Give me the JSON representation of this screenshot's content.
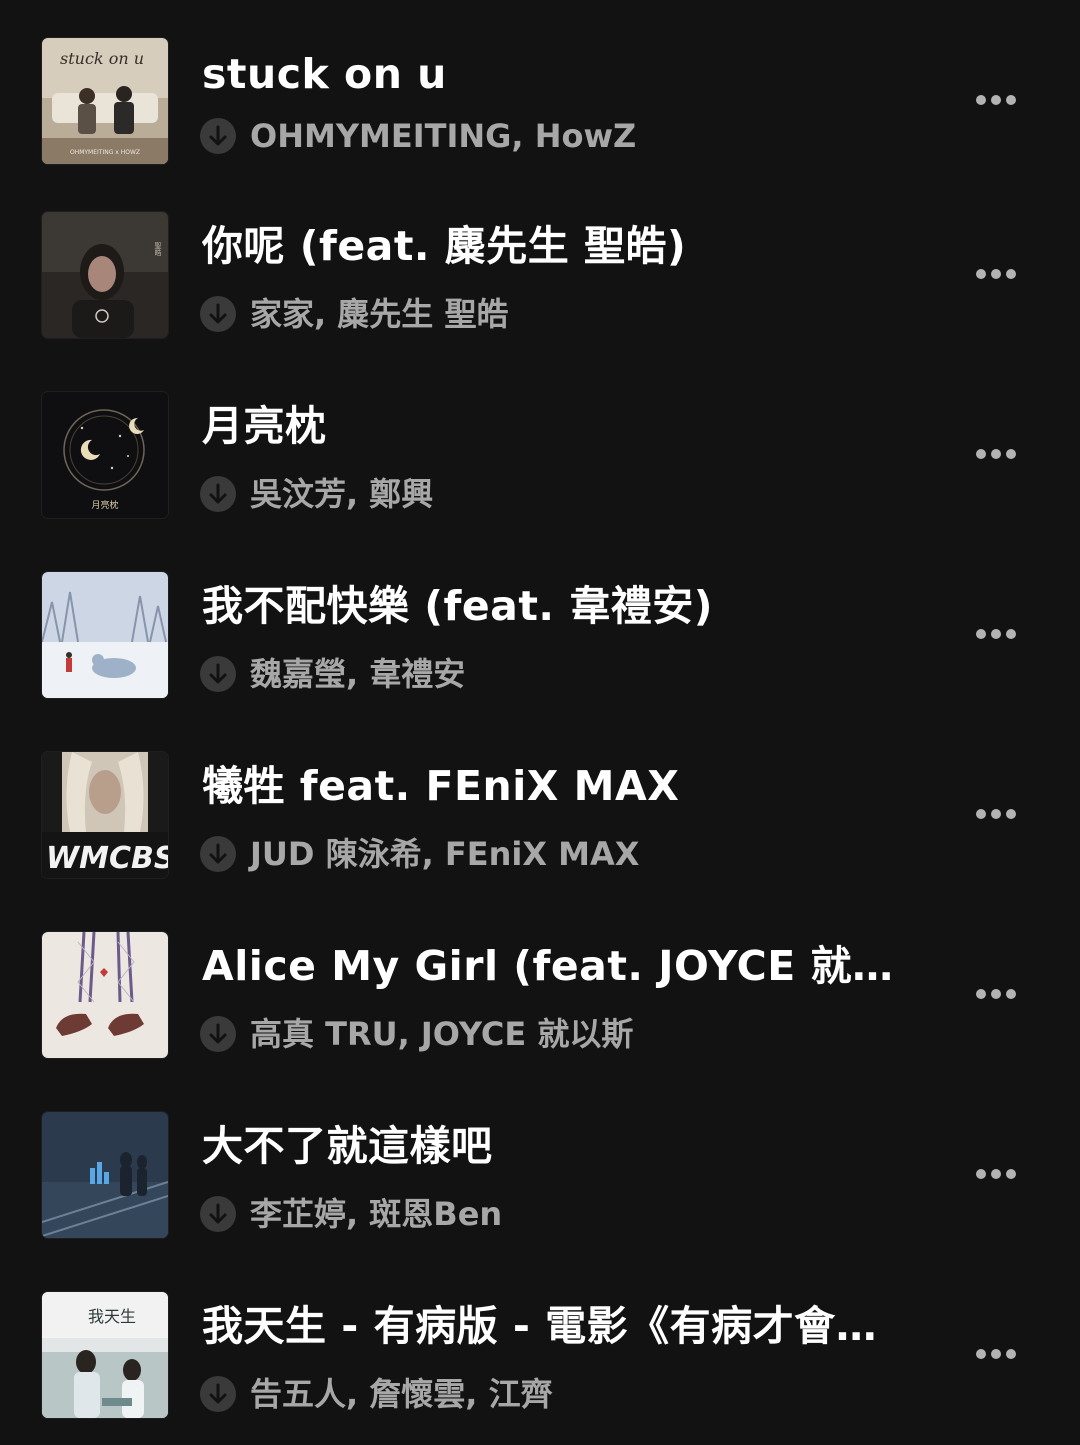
{
  "tracks": [
    {
      "title": "stuck on u",
      "artists": "OHMYMEITING, HowZ",
      "cover_text": "stuck on u",
      "cover_subtext": "OHMYMEITING x HOWZ",
      "cover_colors": [
        "#d8cfc0",
        "#8a7a66"
      ]
    },
    {
      "title": "你呢 (feat. 麋先生 聖皓)",
      "artists": "家家, 麋先生 聖皓",
      "cover_text": "",
      "cover_subtext": "",
      "cover_colors": [
        "#2a2724",
        "#5a4e45"
      ]
    },
    {
      "title": "月亮枕",
      "artists": "吳汶芳, 鄭興",
      "cover_text": "月亮枕",
      "cover_subtext": "",
      "cover_colors": [
        "#101012",
        "#3a3428"
      ]
    },
    {
      "title": "我不配快樂 (feat. 韋禮安)",
      "artists": "魏嘉瑩, 韋禮安",
      "cover_text": "",
      "cover_subtext": "",
      "cover_colors": [
        "#cfd8e6",
        "#8f9cb3"
      ]
    },
    {
      "title": "犧牲 feat. FEniX MAX",
      "artists": "JUD 陳泳希, FEniX MAX",
      "cover_text": "WMCBS",
      "cover_subtext": "",
      "cover_colors": [
        "#1a1a1a",
        "#cfc6b8"
      ]
    },
    {
      "title": "Alice My Girl (feat. JOYCE 就以…",
      "artists": "高真 TRU, JOYCE 就以斯",
      "cover_text": "",
      "cover_subtext": "",
      "cover_colors": [
        "#e7e3dc",
        "#6e3a34"
      ]
    },
    {
      "title": "大不了就這樣吧",
      "artists": "李芷婷, 斑恩Ben",
      "cover_text": "",
      "cover_subtext": "",
      "cover_colors": [
        "#2b3b4d",
        "#5a6e80"
      ]
    },
    {
      "title": "我天生 - 有病版 - 電影《有病才會…",
      "artists": "告五人, 詹懷雲, 江齊",
      "cover_text": "我天生",
      "cover_subtext": "",
      "cover_colors": [
        "#e3e6e6",
        "#6f8a8c"
      ]
    }
  ],
  "colors": {
    "background": "#121212",
    "title": "#ffffff",
    "subtitle": "#a7a7a7",
    "icon": "#b3b3b3"
  },
  "icons": {
    "download": "download-arrow-circle-icon",
    "more": "more-horizontal-icon"
  }
}
